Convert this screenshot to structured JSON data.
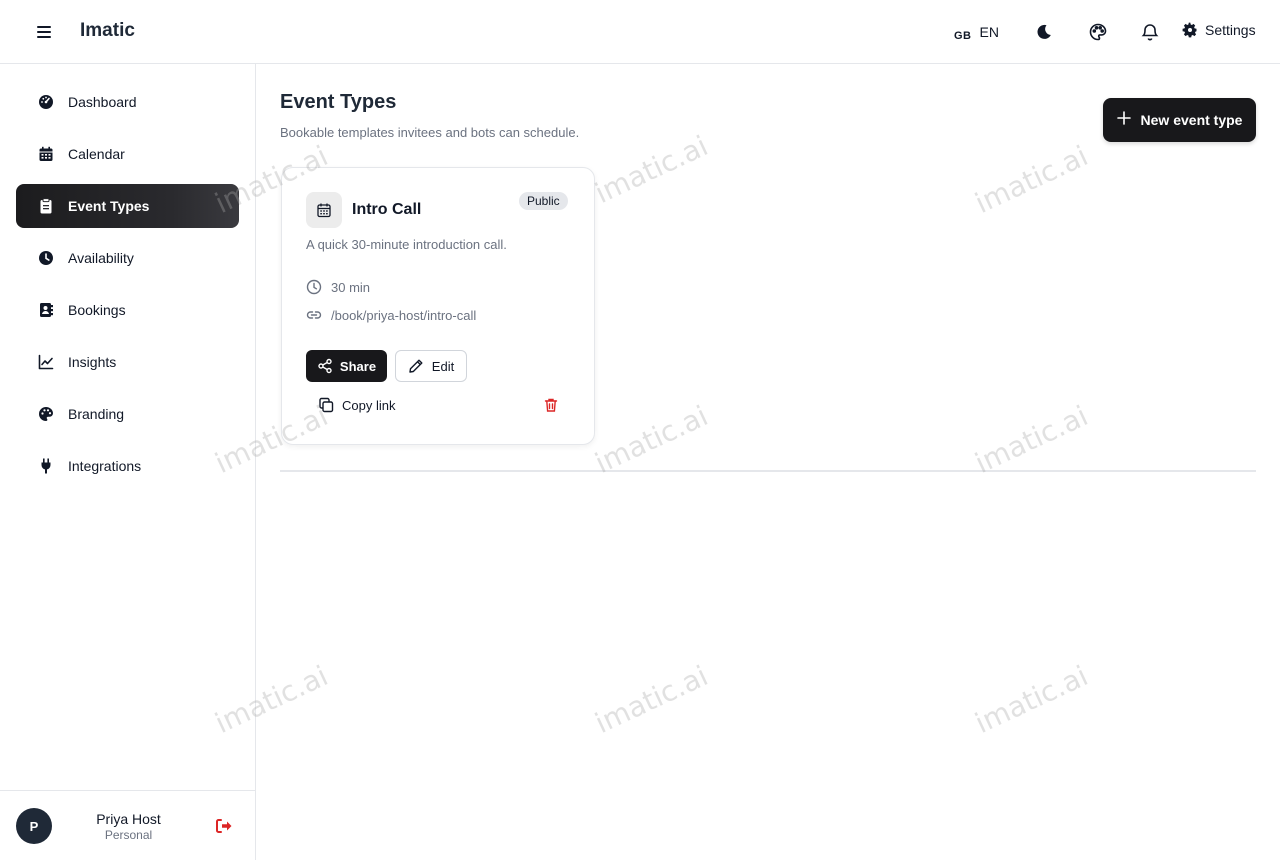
{
  "header": {
    "app_title": "Imatic",
    "language_flag": "GB",
    "language_code": "EN",
    "settings_label": "Settings",
    "icons": [
      "menu-icon",
      "moon-icon",
      "palette-icon",
      "bell-icon",
      "gear-icon"
    ]
  },
  "sidebar": {
    "items": [
      {
        "label": "Dashboard",
        "icon": "dashboard-icon",
        "active": false
      },
      {
        "label": "Calendar",
        "icon": "calendar-icon",
        "active": false
      },
      {
        "label": "Event Types",
        "icon": "clipboard-icon",
        "active": true
      },
      {
        "label": "Availability",
        "icon": "clock-icon",
        "active": false
      },
      {
        "label": "Bookings",
        "icon": "address-book-icon",
        "active": false
      },
      {
        "label": "Insights",
        "icon": "chart-line-icon",
        "active": false
      },
      {
        "label": "Branding",
        "icon": "palette-icon",
        "active": false
      },
      {
        "label": "Integrations",
        "icon": "plug-icon",
        "active": false
      }
    ],
    "user": {
      "initial": "P",
      "name": "Priya Host",
      "plan": "Personal"
    }
  },
  "main": {
    "title": "Event Types",
    "subtitle": "Bookable templates invitees and bots can schedule.",
    "new_button_label": "New event type",
    "event_card": {
      "title": "Intro Call",
      "visibility_badge": "Public",
      "description": "A quick 30-minute introduction call.",
      "duration": "30 min",
      "link": "/book/priya-host/intro-call",
      "share_label": "Share",
      "edit_label": "Edit",
      "copy_link_label": "Copy link"
    }
  },
  "watermark": "imatic.ai",
  "colors": {
    "primary_dark": "#18181b",
    "danger": "#dc2626",
    "muted_text": "#6b7280",
    "border": "#e5e7eb"
  }
}
